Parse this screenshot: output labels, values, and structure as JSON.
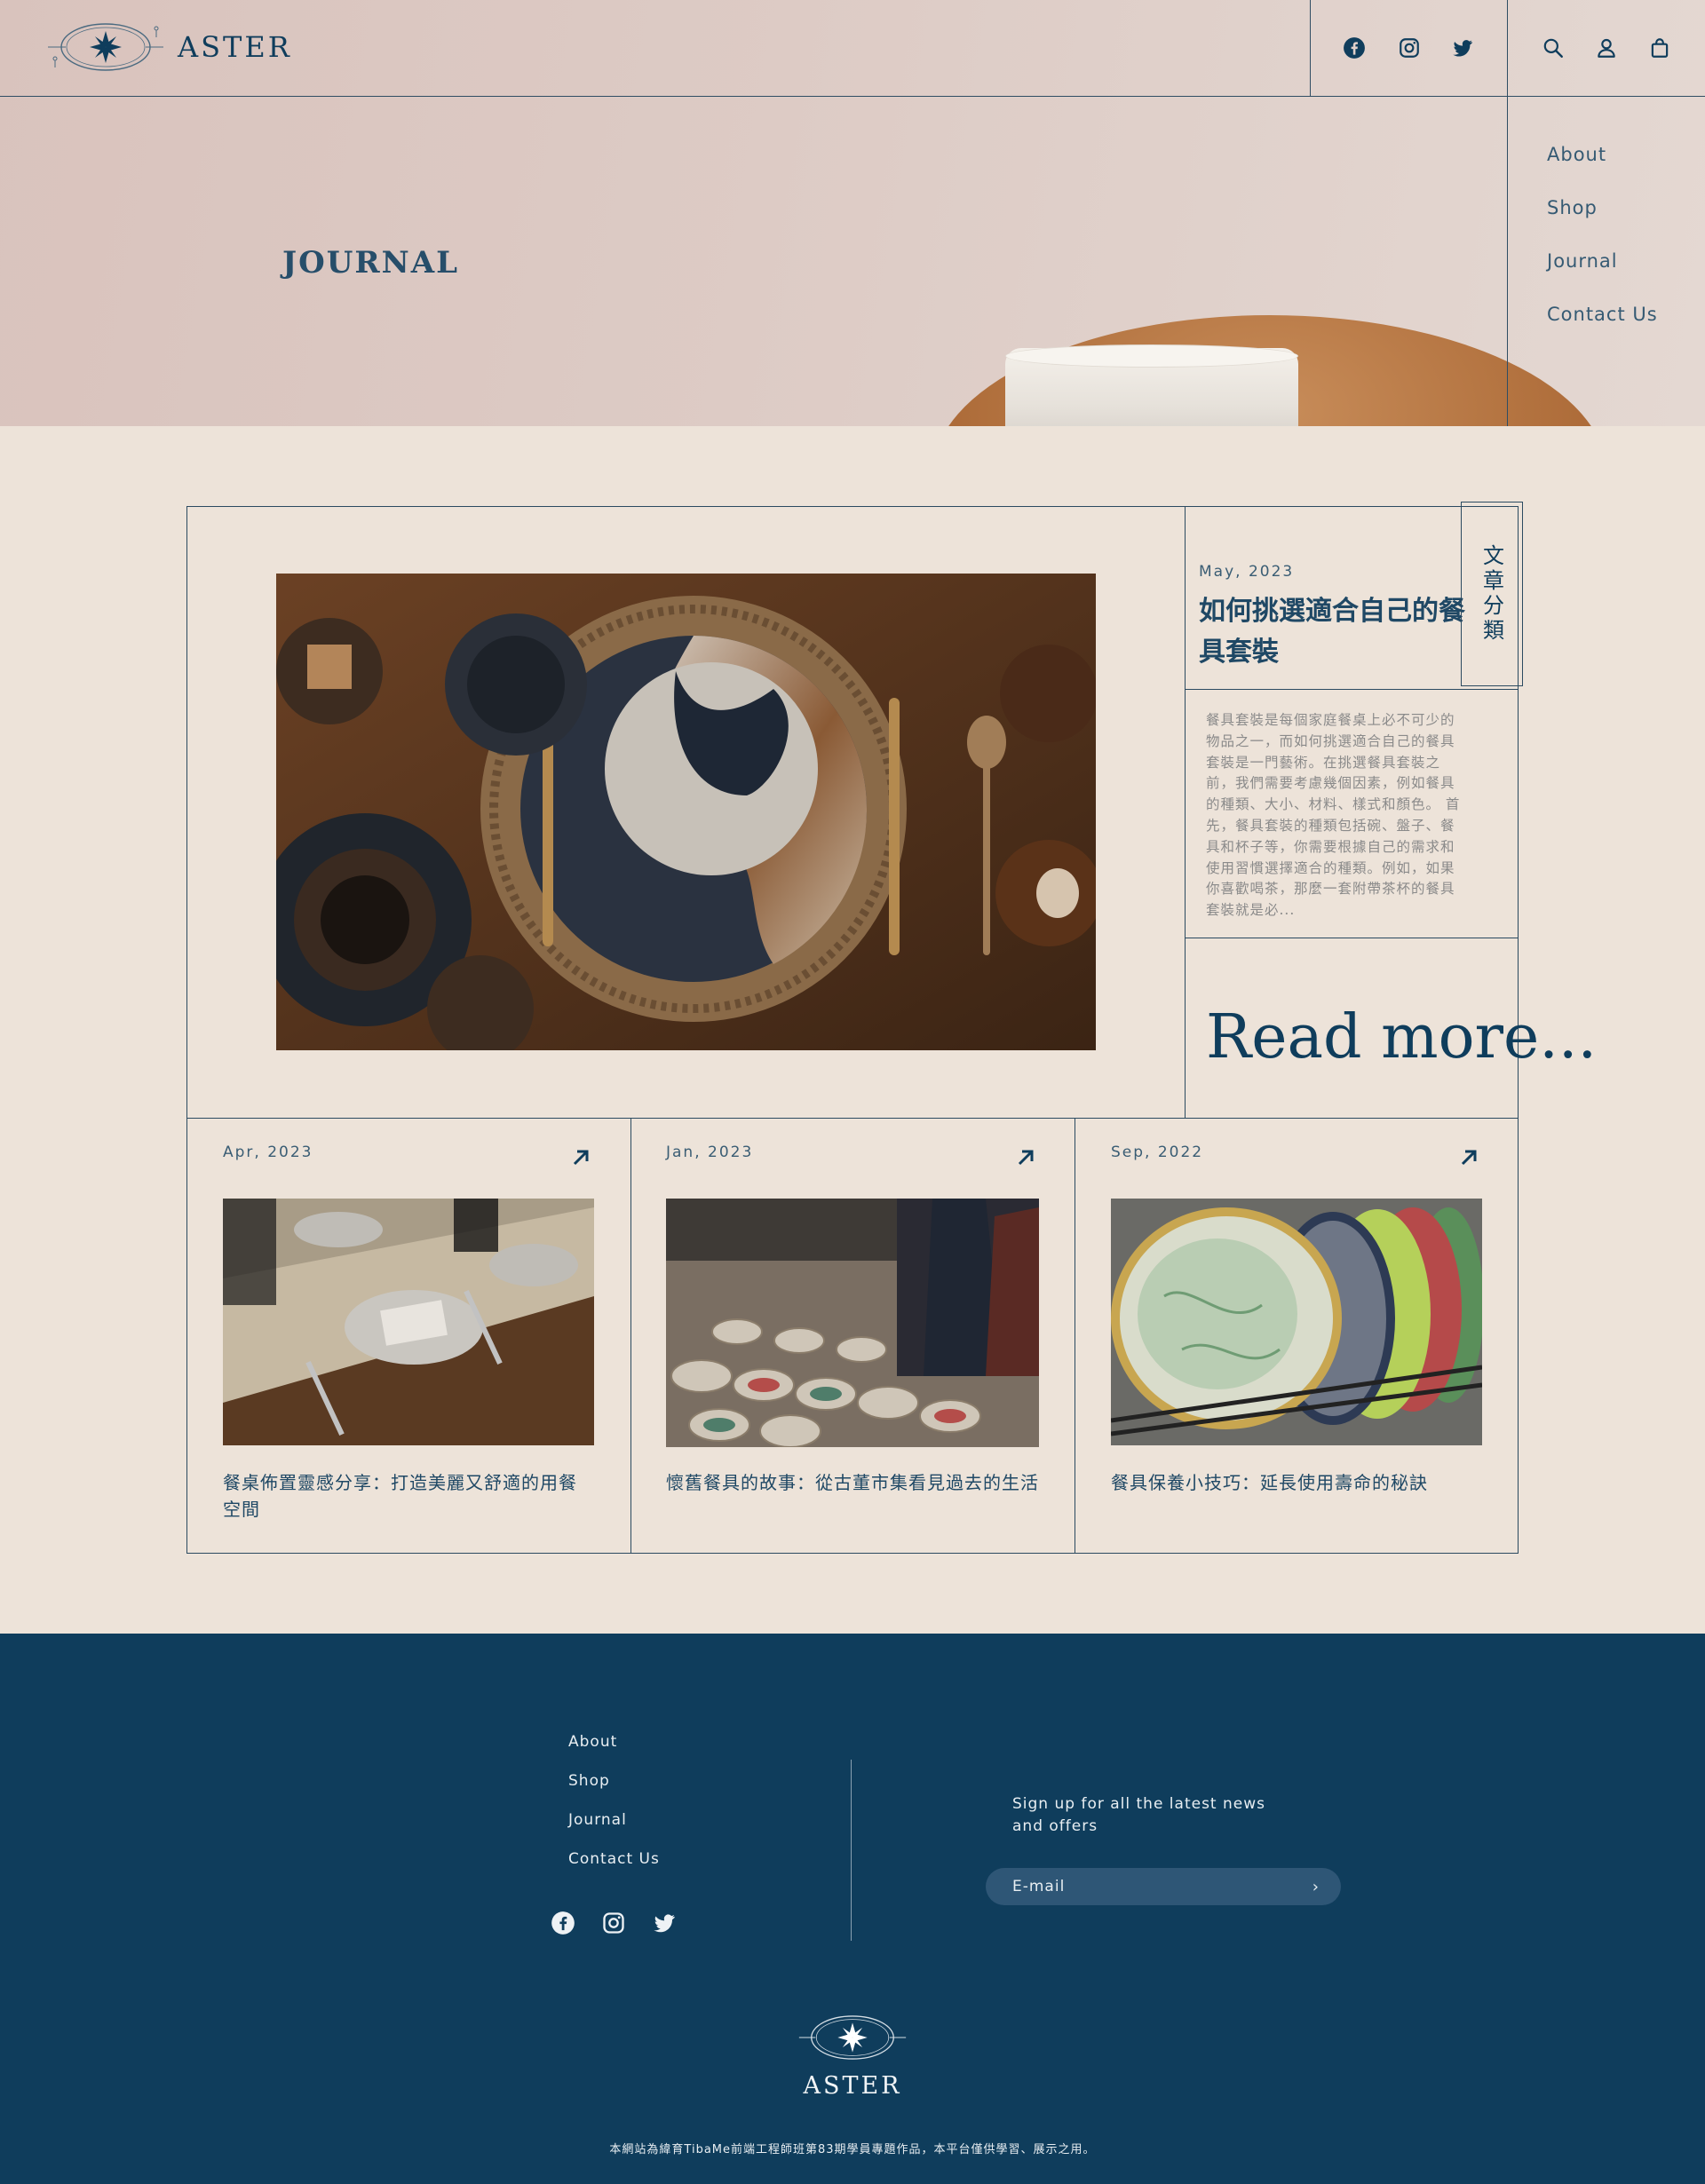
{
  "brand": {
    "name": "ASTER"
  },
  "header": {
    "social": [
      {
        "icon": "facebook-icon"
      },
      {
        "icon": "instagram-icon"
      },
      {
        "icon": "twitter-icon"
      }
    ],
    "actions": [
      {
        "icon": "search-icon"
      },
      {
        "icon": "user-icon"
      },
      {
        "icon": "bag-icon"
      }
    ]
  },
  "side_menu": [
    "About",
    "Shop",
    "Journal",
    "Contact Us"
  ],
  "hero": {
    "title": "JOURNAL"
  },
  "featured": {
    "date": "May, 2023",
    "title": "如何挑選適合自己的餐具套裝",
    "excerpt": "餐具套裝是每個家庭餐桌上必不可少的物品之一，而如何挑選適合自己的餐具套裝是一門藝術。在挑選餐具套裝之前，我們需要考慮幾個因素，例如餐具的種類、大小、材料、樣式和顏色。 首先，餐具套裝的種類包括碗、盤子、餐具和杯子等，你需要根據自己的需求和使用習慣選擇適合的種類。例如，如果你喜歡喝茶，那麼一套附帶茶杯的餐具套裝就是必...",
    "read_more": "Read more...",
    "category_label": "文章分類"
  },
  "posts": [
    {
      "date": "Apr, 2023",
      "title": "餐桌佈置靈感分享：打造美麗又舒適的用餐空間"
    },
    {
      "date": "Jan, 2023",
      "title": "懷舊餐具的故事：從古董市集看見過去的生活"
    },
    {
      "date": "Sep, 2022",
      "title": "餐具保養小技巧：延長使用壽命的秘訣"
    }
  ],
  "footer": {
    "links": [
      "About",
      "Shop",
      "Journal",
      "Contact Us"
    ],
    "signup_text": "Sign up for all the latest news and offers",
    "email_placeholder": "E-mail",
    "submit_icon": "chevron-right-icon",
    "brand": "ASTER",
    "note": "本網站為緯育TibaMe前端工程師班第83期學員專題作品，本平台僅供學習、展示之用。"
  },
  "colors": {
    "navy": "#0f3d5c",
    "cream": "#ede3d9",
    "hero_pink": "#dccac4"
  }
}
